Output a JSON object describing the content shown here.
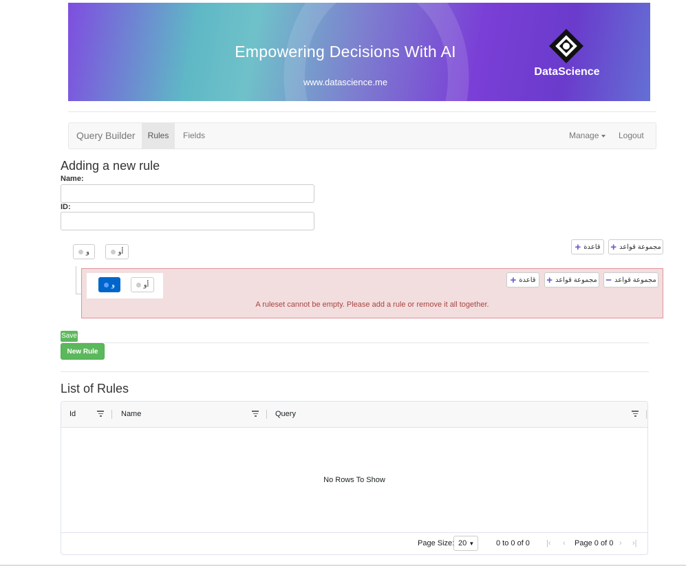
{
  "banner": {
    "headline": "Empowering Decisions With AI",
    "url": "www.datascience.me",
    "brand": "DataScience"
  },
  "navbar": {
    "brand": "Query Builder",
    "items": [
      "Rules",
      "Fields"
    ],
    "manage": "Manage",
    "logout": "Logout"
  },
  "form": {
    "title": "Adding a new rule",
    "name_label": "Name:",
    "id_label": "ID:",
    "name_value": "",
    "id_value": ""
  },
  "builder": {
    "and_label": "و",
    "or_label": "أو",
    "add_rule": "قاعدة",
    "add_group": "مجموعة قواعد",
    "delete_group": "مجموعة قواعد",
    "error": "A ruleset cannot be empty. Please add a rule or remove it all together."
  },
  "actions": {
    "save": "Save",
    "new_rule": "New Rule"
  },
  "list": {
    "title": "List of Rules",
    "columns": [
      "Id",
      "Name",
      "Query"
    ],
    "empty": "No Rows To Show",
    "page_size_label": "Page Size:",
    "page_size": "20",
    "range": "0 to 0 of 0",
    "page_word": "Page",
    "page_current": "0",
    "page_of": "of",
    "page_total": "0"
  },
  "colors": {
    "success": "#5cb85c",
    "primary": "#0066cc",
    "error_bg": "#f2dede",
    "error_text": "#a94442",
    "icon": "#6a5acd"
  }
}
